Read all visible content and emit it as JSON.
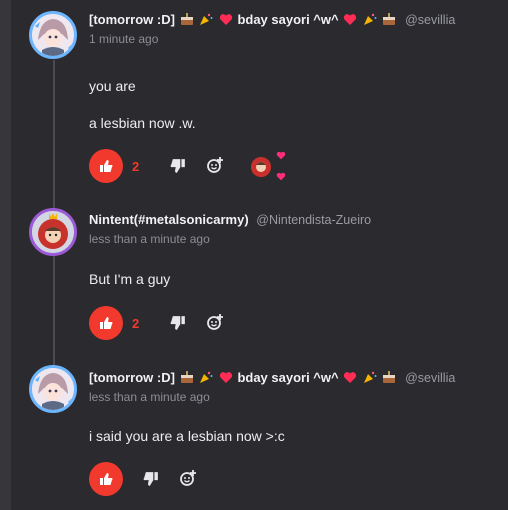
{
  "posts": [
    {
      "author_name": "[tomorrow :D]",
      "author_suffix": "bday sayori ^w^",
      "handle": "@sevillia",
      "time": "1 minute ago",
      "lines": [
        "you are",
        "a lesbian now .w."
      ],
      "likes": "2"
    },
    {
      "author_name": "Nintent(#metalsonicarmy)",
      "handle": "@Nintendista-Zueiro",
      "time": "less than a minute ago",
      "lines": [
        "But I'm a guy"
      ],
      "likes": "2"
    },
    {
      "author_name": "[tomorrow :D]",
      "author_suffix": "bday sayori ^w^",
      "handle": "@sevillia",
      "time": "less than a minute ago",
      "lines": [
        "i said you are a lesbian now >:c"
      ],
      "likes": ""
    }
  ],
  "colors": {
    "like": "#f13a2d",
    "background": "#2a2a2f",
    "reaction_heart": "#ff2d7a"
  },
  "icons": [
    "cake-icon",
    "party-popper-icon",
    "heart-icon",
    "thumbs-up-icon",
    "thumbs-down-icon",
    "add-reaction-icon"
  ]
}
